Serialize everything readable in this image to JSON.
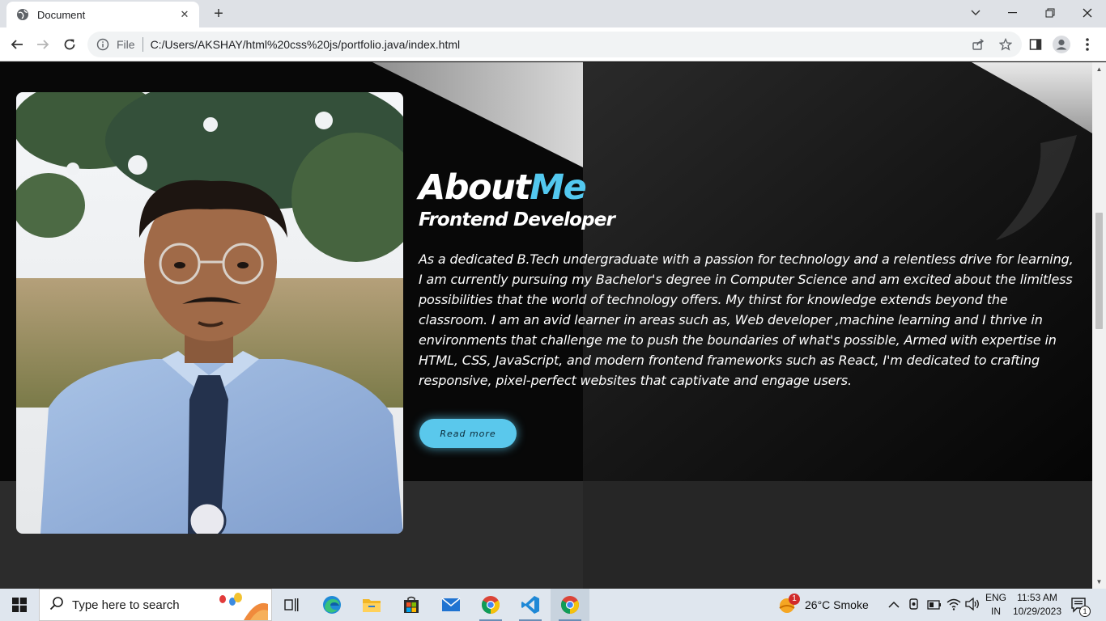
{
  "browser": {
    "tab_title": "Document",
    "tab_close": "✕",
    "new_tab": "+",
    "address_label": "File",
    "url": "C:/Users/AKSHAY/html%20css%20js/portfolio.java/index.html"
  },
  "about": {
    "heading_main": "About",
    "heading_accent": "Me",
    "subheading": "Frontend Developer",
    "paragraph": "As a dedicated B.Tech undergraduate with a passion for technology and a relentless drive for learning, I am currently pursuing my Bachelor's degree in Computer Science and am excited about the limitless possibilities that the world of technology offers. My thirst for knowledge extends beyond the classroom. I am an avid learner in areas such as, Web developer ,machine learning and I thrive in environments that challenge me to push the boundaries of what's possible, Armed with expertise in HTML, CSS, JavaScript, and modern frontend frameworks such as React, I'm dedicated to crafting responsive, pixel-perfect websites that captivate and engage users.",
    "button_label": "Read more"
  },
  "taskbar": {
    "search_placeholder": "Type here to search",
    "weather": "26°C  Smoke",
    "weather_badge": "1",
    "lang_top": "ENG",
    "lang_bottom": "IN",
    "time": "11:53 AM",
    "date": "10/29/2023",
    "notification_count": "1"
  },
  "colors": {
    "accent": "#53c8ef",
    "button": "#5ac8ec",
    "page_background": "#0a0a0a"
  }
}
